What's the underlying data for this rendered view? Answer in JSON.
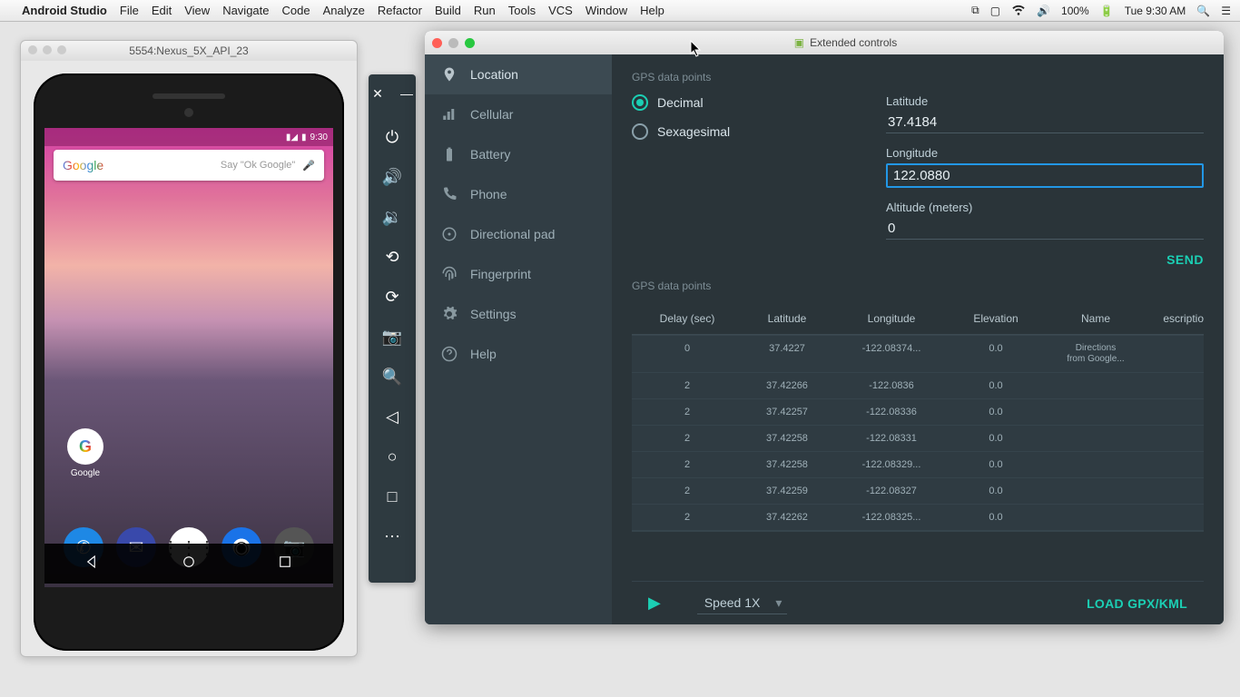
{
  "menubar": {
    "app": "Android Studio",
    "items": [
      "File",
      "Edit",
      "View",
      "Navigate",
      "Code",
      "Analyze",
      "Refactor",
      "Build",
      "Run",
      "Tools",
      "VCS",
      "Window",
      "Help"
    ],
    "battery": "100%",
    "clock": "Tue 9:30 AM"
  },
  "emulator": {
    "title": "5554:Nexus_5X_API_23",
    "status_time": "9:30",
    "search_logo": "Google",
    "search_hint": "Say \"Ok Google\"",
    "folder_label": "Google"
  },
  "ext": {
    "title": "Extended controls",
    "sidebar": [
      {
        "label": "Location",
        "active": true
      },
      {
        "label": "Cellular",
        "active": false
      },
      {
        "label": "Battery",
        "active": false
      },
      {
        "label": "Phone",
        "active": false
      },
      {
        "label": "Directional pad",
        "active": false
      },
      {
        "label": "Fingerprint",
        "active": false
      },
      {
        "label": "Settings",
        "active": false
      },
      {
        "label": "Help",
        "active": false
      }
    ],
    "section1": "GPS data points",
    "radios": {
      "decimal": "Decimal",
      "sexagesimal": "Sexagesimal"
    },
    "fields": {
      "lat_label": "Latitude",
      "lat_value": "37.4184",
      "lon_label": "Longitude",
      "lon_value": "122.0880",
      "alt_label": "Altitude (meters)",
      "alt_value": "0"
    },
    "send": "SEND",
    "section2": "GPS data points",
    "table": {
      "headers": [
        "Delay (sec)",
        "Latitude",
        "Longitude",
        "Elevation",
        "Name",
        "escription"
      ],
      "rows": [
        {
          "delay": "0",
          "lat": "37.4227",
          "lon": "-122.08374...",
          "elev": "0.0",
          "name": "Directions from Google...",
          "desc": ""
        },
        {
          "delay": "2",
          "lat": "37.42266",
          "lon": "-122.0836",
          "elev": "0.0",
          "name": "",
          "desc": ""
        },
        {
          "delay": "2",
          "lat": "37.42257",
          "lon": "-122.08336",
          "elev": "0.0",
          "name": "",
          "desc": ""
        },
        {
          "delay": "2",
          "lat": "37.42258",
          "lon": "-122.08331",
          "elev": "0.0",
          "name": "",
          "desc": ""
        },
        {
          "delay": "2",
          "lat": "37.42258",
          "lon": "-122.08329...",
          "elev": "0.0",
          "name": "",
          "desc": ""
        },
        {
          "delay": "2",
          "lat": "37.42259",
          "lon": "-122.08327",
          "elev": "0.0",
          "name": "",
          "desc": ""
        },
        {
          "delay": "2",
          "lat": "37.42262",
          "lon": "-122.08325...",
          "elev": "0.0",
          "name": "",
          "desc": ""
        }
      ]
    },
    "speed": "Speed 1X",
    "load": "LOAD GPX/KML"
  }
}
